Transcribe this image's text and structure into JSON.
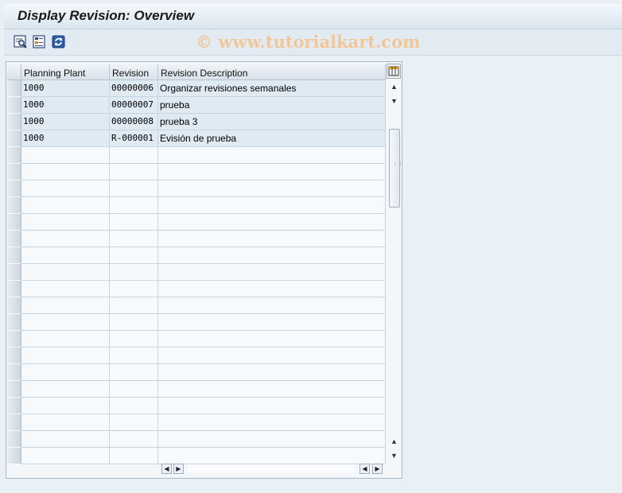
{
  "window": {
    "title": "Display Revision: Overview"
  },
  "toolbar": {
    "buttons": [
      {
        "icon": "details-icon"
      },
      {
        "icon": "selection-icon"
      },
      {
        "icon": "refresh-icon"
      }
    ]
  },
  "watermark": "© www.tutorialkart.com",
  "table": {
    "columns": [
      "Planning Plant",
      "Revision",
      "Revision Description"
    ],
    "rows": [
      {
        "plant": "1000",
        "revision": "00000006",
        "description": "Organizar revisiones semanales"
      },
      {
        "plant": "1000",
        "revision": "00000007",
        "description": "prueba"
      },
      {
        "plant": "1000",
        "revision": "00000008",
        "description": "prueba 3"
      },
      {
        "plant": "1000",
        "revision": "R-000001",
        "description": "Evisión de prueba"
      }
    ],
    "empty_row_count": 19
  },
  "colors": {
    "accent": "#dfeaf3",
    "background": "#e9f0f6"
  }
}
